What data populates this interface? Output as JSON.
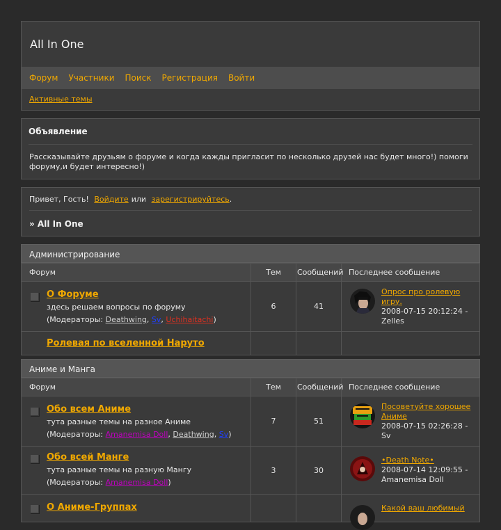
{
  "site": {
    "title": "All In One",
    "nav": [
      "Форум",
      "Участники",
      "Поиск",
      "Регистрация",
      "Войти"
    ],
    "subnav_link": "Активные темы"
  },
  "announcement": {
    "title": "Объявление",
    "text": "Рассказывайте друзьям о форуме и когда кажды пригласит по несколько друзей нас будет много!) помоги форуму,и будет интересно!)"
  },
  "welcome": {
    "greeting": "Привет, Гость!",
    "login_link": "Войдите",
    "or": "или",
    "register_link": "зарегистрируйтесь",
    "period": ".",
    "breadcrumb": "» All In One"
  },
  "table_headers": {
    "forum": "Форум",
    "topics": "Тем",
    "posts": "Сообщений",
    "last": "Последнее сообщение"
  },
  "moderators_label": "Модераторы:",
  "categories": [
    {
      "title": "Администрирование",
      "forums": [
        {
          "name": "О Форуме",
          "desc": "здесь решаем вопросы по форуму",
          "moderators": [
            "Deathwing",
            "Sv",
            "Uchihaitachi"
          ],
          "topics": "6",
          "posts": "41",
          "last_title": "Опрос про ролевую игру.",
          "last_meta": "2008-07-15 20:12:24 - Zelles"
        },
        {
          "name": "Ролевая по вселенной Наруто"
        }
      ]
    },
    {
      "title": "Аниме и Манга",
      "forums": [
        {
          "name": "Обо всем Аниме",
          "desc": "тута разные темы на разное Аниме",
          "moderators": [
            "Amanemisa Doll",
            "Deathwing",
            "Sv"
          ],
          "topics": "7",
          "posts": "51",
          "last_title": "Посоветуйте хорошее Аниме",
          "last_meta": "2008-07-15 02:26:28 - Sv"
        },
        {
          "name": "Обо всей Манге",
          "desc": "тута разные темы на разную Мангу",
          "moderators": [
            "Amanemisa Doll"
          ],
          "topics": "3",
          "posts": "30",
          "last_title": "•Death Note•",
          "last_meta": "2008-07-14 12:09:55 - Amanemisa Doll"
        },
        {
          "name": "О Аниме-Группах",
          "last_title": "Какой ваш любимый"
        }
      ]
    }
  ]
}
